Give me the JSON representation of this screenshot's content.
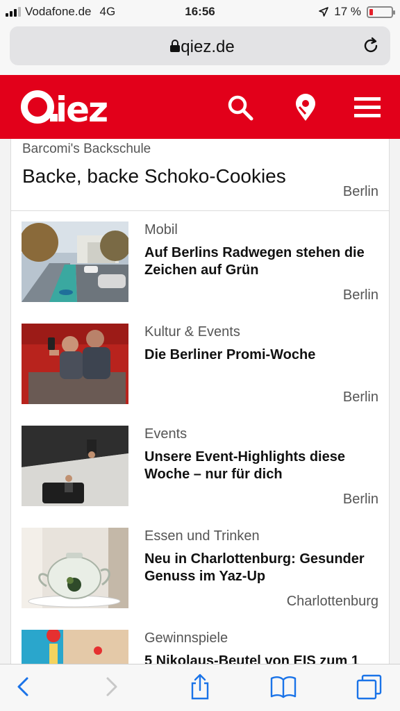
{
  "status_bar": {
    "carrier": "Vodafone.de",
    "network": "4G",
    "time": "16:56",
    "battery_percent": "17 %",
    "battery_level": 0.17,
    "battery_color": "#e5202a"
  },
  "browser": {
    "url": "qiez.de"
  },
  "site": {
    "logo": "Qiez",
    "brand_color": "#e2001a",
    "icons": [
      "search-icon",
      "location-pin-icon",
      "menu-icon"
    ]
  },
  "featured": {
    "category": "Barcomi's Backschule",
    "title": "Backe, backe Schoko-Cookies",
    "location": "Berlin"
  },
  "articles": [
    {
      "category": "Mobil",
      "title": "Auf Berlins Radwegen stehen die Zeichen auf Grün",
      "location": "Berlin"
    },
    {
      "category": "Kultur & Events",
      "title": "Die Berliner Promi-Woche",
      "location": "Berlin"
    },
    {
      "category": "Events",
      "title": "Unsere Event-Highlights diese Woche – nur für dich",
      "location": "Berlin"
    },
    {
      "category": "Essen und Trinken",
      "title": "Neu in Charlottenburg: Gesunder Genuss im Yaz-Up",
      "location": "Charlottenburg"
    },
    {
      "category": "Gewinnspiele",
      "title": "5 Nikolaus-Beutel von EIS zum 1",
      "location": ""
    }
  ],
  "toolbar": {
    "icons": [
      "back-icon",
      "forward-icon",
      "share-icon",
      "bookmarks-icon",
      "tabs-icon"
    ]
  }
}
